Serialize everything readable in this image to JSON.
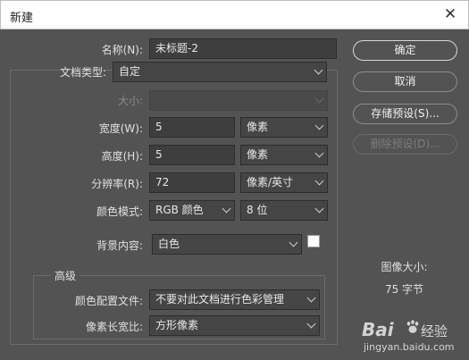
{
  "window": {
    "title": "新建",
    "close_glyph": "✕"
  },
  "name": {
    "label": "名称(N):",
    "value": "未标题-2"
  },
  "doc_type": {
    "label": "文档类型:",
    "value": "自定"
  },
  "size": {
    "label": "大小:",
    "value": ""
  },
  "width": {
    "label": "宽度(W):",
    "value": "5",
    "unit": "像素"
  },
  "height": {
    "label": "高度(H):",
    "value": "5",
    "unit": "像素"
  },
  "resolution": {
    "label": "分辨率(R):",
    "value": "72",
    "unit": "像素/英寸"
  },
  "color_mode": {
    "label": "颜色模式:",
    "mode": "RGB 颜色",
    "bits": "8 位"
  },
  "background": {
    "label": "背景内容:",
    "value": "白色",
    "swatch_color": "#ffffff"
  },
  "advanced": {
    "title": "高级",
    "color_profile": {
      "label": "颜色配置文件:",
      "value": "不要对此文档进行色彩管理"
    },
    "pixel_aspect": {
      "label": "像素长宽比:",
      "value": "方形像素"
    }
  },
  "buttons": {
    "ok": "确定",
    "cancel": "取消",
    "save_preset": "存储预设(S)...",
    "delete_preset": "删除预设(D)..."
  },
  "image_size": {
    "label": "图像大小:",
    "value": "75 字节"
  },
  "watermark": {
    "logo": "Bai",
    "brand": "经验",
    "url": "jingyan.baidu.com"
  },
  "colors": {
    "dialog_bg": "#535353",
    "field_bg": "#454545",
    "titlebar_bg": "#ffffff"
  }
}
